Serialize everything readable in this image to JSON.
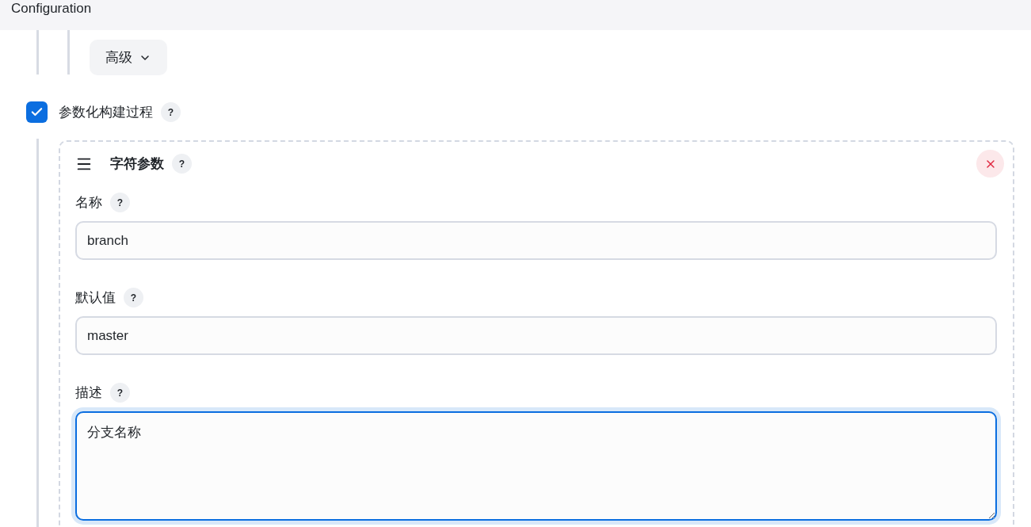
{
  "header": {
    "title": "Configuration"
  },
  "advanced_button": {
    "label": "高级"
  },
  "parameterized": {
    "label": "参数化构建过程",
    "checked": true,
    "help": "?"
  },
  "parameter": {
    "title": "字符参数",
    "help": "?",
    "fields": [
      {
        "kind": "input",
        "label": "名称",
        "help": "?",
        "value": "branch",
        "focused": false
      },
      {
        "kind": "input",
        "label": "默认值",
        "help": "?",
        "value": "master",
        "focused": false
      },
      {
        "kind": "textarea",
        "label": "描述",
        "help": "?",
        "value": "分支名称",
        "focused": true
      }
    ]
  }
}
